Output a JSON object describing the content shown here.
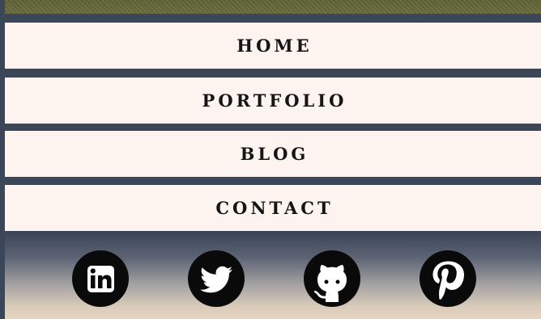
{
  "nav": {
    "items": [
      {
        "label": "HOME"
      },
      {
        "label": "PORTFOLIO"
      },
      {
        "label": "BLOG"
      },
      {
        "label": "CONTACT"
      }
    ]
  },
  "social": {
    "icons": [
      "linkedin-icon",
      "twitter-icon",
      "github-icon",
      "pinterest-icon"
    ]
  },
  "colors": {
    "page_background": "#3b4658",
    "nav_background": "#fdf4ef",
    "nav_text": "#151515",
    "olive_band": "#646638",
    "icon_fill": "#0a0a0a"
  }
}
